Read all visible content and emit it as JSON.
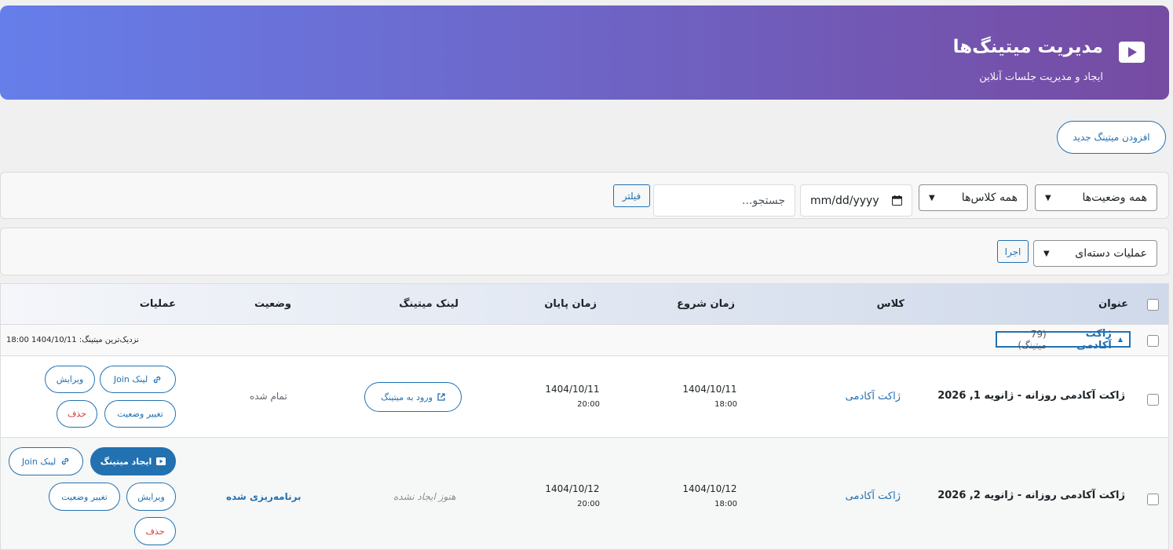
{
  "header": {
    "title": "مدیریت میتینگ‌ها",
    "subtitle": "ایجاد و مدیریت جلسات آنلاین",
    "icon": "video-play-icon",
    "gradient_start": "#667eea",
    "gradient_end": "#764ba2"
  },
  "actions": {
    "add_new_label": "افزودن میتینگ جدید"
  },
  "filters": {
    "status_selected": "همه وضعیت‌ها",
    "class_selected": "همه کلاس‌ها",
    "date_placeholder": "mm/dd/yyyy",
    "search_placeholder": "جستجو...",
    "filter_button": "فیلتر"
  },
  "bulk": {
    "action_selected": "عملیات دسته‌ای",
    "apply_button": "اجرا"
  },
  "table": {
    "columns": {
      "title": "عنوان",
      "class": "کلاس",
      "start": "زمان شروع",
      "end": "زمان پایان",
      "link": "لینک میتینگ",
      "status": "وضعیت",
      "operations": "عملیات"
    },
    "group": {
      "name": "ژاکت آکادمی",
      "count": "(79 میتینگ)",
      "nearest": "نزدیک‌ترین میتینگ: 1404/10/11 18:00"
    },
    "rows": [
      {
        "title": "ژاکت آکادمی روزانه - ژانویه 1, 2026",
        "class": "ژاکت آکادمی",
        "start_date": "1404/10/11",
        "start_time": "18:00",
        "end_date": "1404/10/11",
        "end_time": "20:00",
        "link_label": "ورود به میتینگ",
        "status": "تمام شده",
        "ops": {
          "join_link": "لینک Join",
          "edit": "ویرایش",
          "change_status": "تغییر وضعیت",
          "delete": "حذف"
        }
      },
      {
        "title": "ژاکت آکادمی روزانه - ژانویه 2, 2026",
        "class": "ژاکت آکادمی",
        "start_date": "1404/10/12",
        "start_time": "18:00",
        "end_date": "1404/10/12",
        "end_time": "20:00",
        "link_label": "هنوز ایجاد نشده",
        "status": "برنامه‌ریزی شده",
        "ops": {
          "create": "ایجاد میتینگ",
          "join_link": "لینک Join",
          "edit": "ویرایش",
          "change_status": "تغییر وضعیت",
          "delete": "حذف"
        }
      }
    ]
  }
}
